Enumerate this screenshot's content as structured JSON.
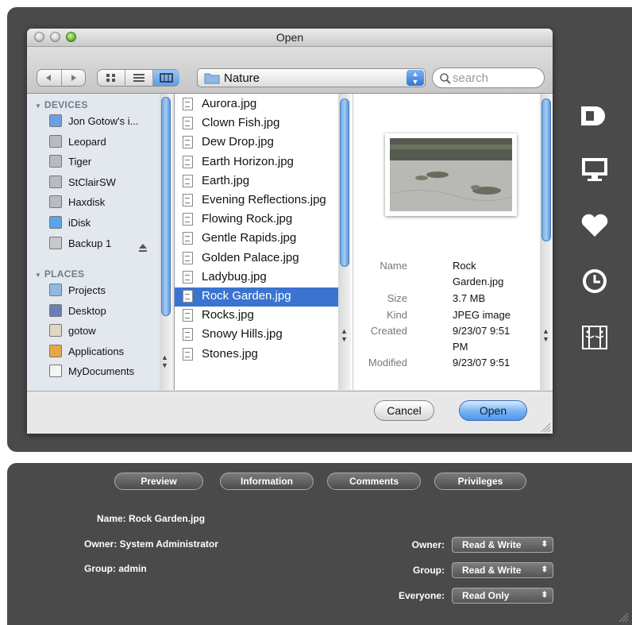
{
  "dialog": {
    "title": "Open",
    "view_controls": {
      "icon_view": "icon-view-icon",
      "list_view": "list-view-icon",
      "column_view": "column-view-icon"
    },
    "location": "Nature",
    "search_placeholder": "search"
  },
  "sidebar": {
    "devices_header": "DEVICES",
    "devices": [
      {
        "label": "Jon Gotow's i...",
        "icon": "computer-icon"
      },
      {
        "label": "Leopard",
        "icon": "hard-disk-icon"
      },
      {
        "label": "Tiger",
        "icon": "hard-disk-icon"
      },
      {
        "label": "StClairSW",
        "icon": "hard-disk-icon"
      },
      {
        "label": "Haxdisk",
        "icon": "hard-disk-icon"
      },
      {
        "label": "iDisk",
        "icon": "idisk-icon"
      },
      {
        "label": "Backup 1",
        "icon": "external-disk-icon"
      }
    ],
    "places_header": "PLACES",
    "places": [
      {
        "label": "Projects",
        "icon": "folder-icon"
      },
      {
        "label": "Desktop",
        "icon": "desktop-icon"
      },
      {
        "label": "gotow",
        "icon": "home-icon"
      },
      {
        "label": "Applications",
        "icon": "applications-icon"
      },
      {
        "label": "MyDocuments",
        "icon": "document-icon"
      }
    ]
  },
  "files": [
    "Aurora.jpg",
    "Clown Fish.jpg",
    "Dew Drop.jpg",
    "Earth Horizon.jpg",
    "Earth.jpg",
    "Evening Reflections.jpg",
    "Flowing Rock.jpg",
    "Gentle Rapids.jpg",
    "Golden Palace.jpg",
    "Ladybug.jpg",
    "Rock Garden.jpg",
    "Rocks.jpg",
    "Snowy Hills.jpg",
    "Stones.jpg"
  ],
  "selected_file": "Rock Garden.jpg",
  "preview": {
    "name_label": "Name",
    "name_value_1": "Rock",
    "name_value_2": "Garden.jpg",
    "size_label": "Size",
    "size_value": "3.7 MB",
    "kind_label": "Kind",
    "kind_value": "JPEG image",
    "created_label": "Created",
    "created_value_1": "9/23/07 9:51",
    "created_value_2": "PM",
    "modified_label": "Modified",
    "modified_value": "9/23/07 9:51"
  },
  "buttons": {
    "cancel": "Cancel",
    "open": "Open"
  },
  "side_icons": [
    "document-drawer-icon",
    "monitor-icon",
    "heart-icon",
    "clock-icon",
    "finder-icon"
  ],
  "info_panel": {
    "tabs": [
      "Preview",
      "Information",
      "Comments",
      "Privileges"
    ],
    "name": "Name: Rock Garden.jpg",
    "owner": "Owner: System Administrator",
    "group": "Group: admin",
    "perm_owner_label": "Owner:",
    "perm_owner_value": "Read & Write",
    "perm_group_label": "Group:",
    "perm_group_value": "Read & Write",
    "perm_everyone_label": "Everyone:",
    "perm_everyone_value": "Read Only"
  }
}
